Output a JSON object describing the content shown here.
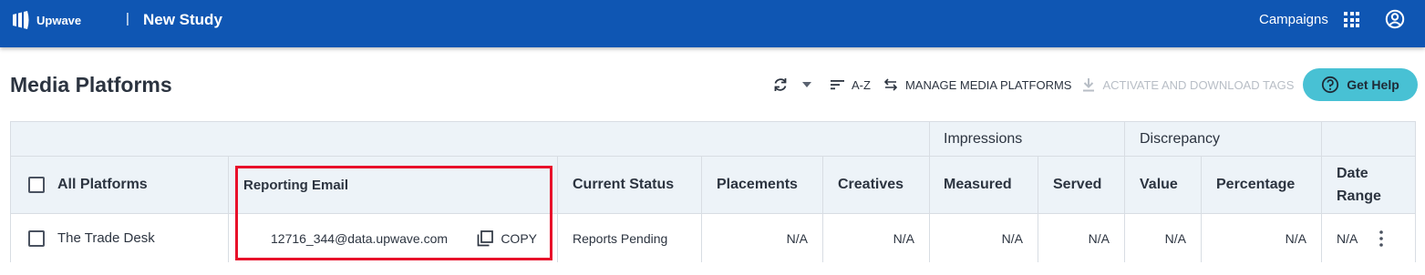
{
  "header": {
    "logo_text": "Upwave",
    "separator": "|",
    "study_title": "New Study",
    "campaigns_label": "Campaigns",
    "apps_icon": "grid-icon",
    "account_icon": "account-circle-icon",
    "bar_color": "#0f56b3"
  },
  "page": {
    "title": "Media Platforms"
  },
  "toolbar": {
    "refresh_icon": "refresh-icon",
    "dropdown_icon": "caret-down-icon",
    "sort_label": "A-Z",
    "manage_label": "MANAGE MEDIA PLATFORMS",
    "activate_label": "ACTIVATE AND DOWNLOAD TAGS",
    "help_label": "Get Help",
    "help_color": "#48c1d4"
  },
  "table": {
    "group_headers": {
      "impressions": "Impressions",
      "discrepancy": "Discrepancy"
    },
    "columns": {
      "all_platforms": "All Platforms",
      "reporting_email": "Reporting Email",
      "current_status": "Current Status",
      "placements": "Placements",
      "creatives": "Creatives",
      "measured": "Measured",
      "served": "Served",
      "value": "Value",
      "percentage": "Percentage",
      "date_range": "Date Range"
    },
    "rows": [
      {
        "platform": "The Trade Desk",
        "email": "12716_344@data.upwave.com",
        "copy_label": "COPY",
        "status": "Reports Pending",
        "placements": "N/A",
        "creatives": "N/A",
        "measured": "N/A",
        "served": "N/A",
        "value": "N/A",
        "percentage": "N/A",
        "date_range": "N/A"
      }
    ]
  },
  "annotation": {
    "highlight_color": "#e8102a"
  }
}
